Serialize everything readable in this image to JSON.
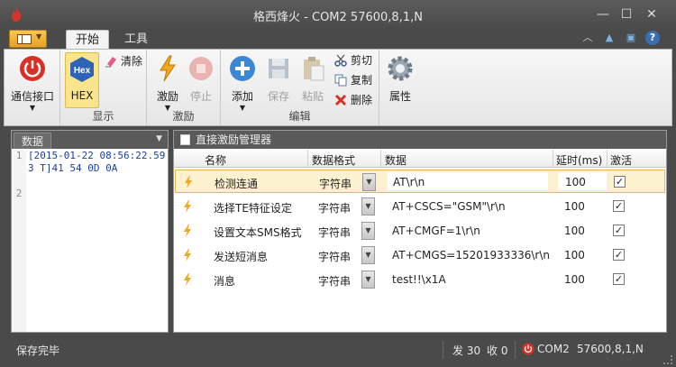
{
  "window": {
    "title": "格西烽火 - COM2  57600,8,1,N"
  },
  "tabs": [
    {
      "label": "开始"
    },
    {
      "label": "工具"
    }
  ],
  "ribbon": {
    "connect_label": "通信接口",
    "hex_label": "HEX",
    "hex_badge": "Hex",
    "clear_label": "清除",
    "group_display": "显示",
    "excite_label": "激励",
    "stop_label": "停止",
    "group_excite": "激励",
    "add_label": "添加",
    "save_label": "保存",
    "paste_label": "粘贴",
    "cut_label": "剪切",
    "copy_label": "复制",
    "delete_label": "删除",
    "props_label": "属性",
    "group_edit": "编辑"
  },
  "data_pane": {
    "tab_label": "数据",
    "line_numbers": [
      "1",
      "2"
    ],
    "line1": "[2015-01-22 08:56:22.593 T]41 54 0D 0A"
  },
  "manager": {
    "title": "直接激励管理器",
    "columns": [
      "名称",
      "数据格式",
      "数据",
      "延时(ms)",
      "激活"
    ],
    "rows": [
      {
        "name": "检测连通",
        "format": "字符串",
        "data": "AT\\r\\n",
        "delay": "100",
        "active": "✓"
      },
      {
        "name": "选择TE特征设定",
        "format": "字符串",
        "data": "AT+CSCS=\"GSM\"\\r\\n",
        "delay": "100",
        "active": "✓"
      },
      {
        "name": "设置文本SMS格式",
        "format": "字符串",
        "data": "AT+CMGF=1\\r\\n",
        "delay": "100",
        "active": "✓"
      },
      {
        "name": "发送短消息",
        "format": "字符串",
        "data": "AT+CMGS=15201933336\\r\\n",
        "delay": "100",
        "active": "✓"
      },
      {
        "name": "消息",
        "format": "字符串",
        "data": "test!!\\x1A",
        "delay": "100",
        "active": "✓"
      }
    ]
  },
  "status": {
    "message": "保存完毕",
    "sent": "发 30",
    "received": "收 0",
    "port": "COM2",
    "params": "57600,8,1,N"
  },
  "colors": {
    "accent": "#e8a220",
    "selection": "#fdf2cf",
    "chrome": "#4a4a4a"
  }
}
